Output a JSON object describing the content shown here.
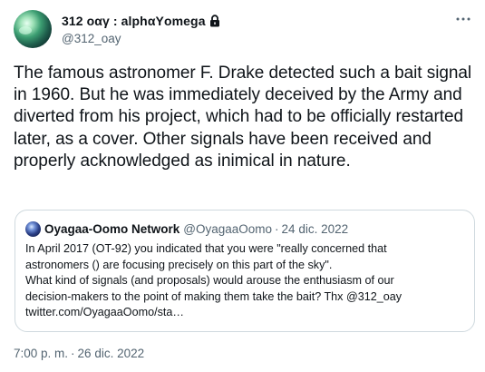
{
  "author": {
    "display_name": "312 οαγ : alphαΥomega",
    "handle": "@312_oay",
    "protected_icon": "lock-icon",
    "avatar_icon": "green-planet-avatar"
  },
  "menu": {
    "more_icon": "more-horizontal-icon"
  },
  "tweet": {
    "text": "The famous astronomer F. Drake detected such a bait signal in 1960. But he was immediately deceived by the Army and diverted from his project, which had to be officially restarted later, as a cover. Other signals have been received and properly acknowledged as inimical in nature."
  },
  "quote": {
    "display_name": "Oyagaa-Oomo Network",
    "handle": "@OyagaaOomo",
    "separator": "·",
    "date": "24 dic. 2022",
    "lines": [
      "In April 2017 (OT-92) you indicated that you were \"really concerned that",
      "astronomers () are focusing precisely on this part of the sky\".",
      "What kind of signals (and proposals) would arouse the enthusiasm of our",
      "decision-makers to the point of making them take the bait? Thx @312_oay",
      "twitter.com/OyagaaOomo/sta…"
    ]
  },
  "timestamp": {
    "time": "7:00 p. m.",
    "separator": "·",
    "date": "26 dic. 2022"
  },
  "colors": {
    "text": "#0f1419",
    "secondary": "#536471",
    "border": "#cfd9de"
  }
}
